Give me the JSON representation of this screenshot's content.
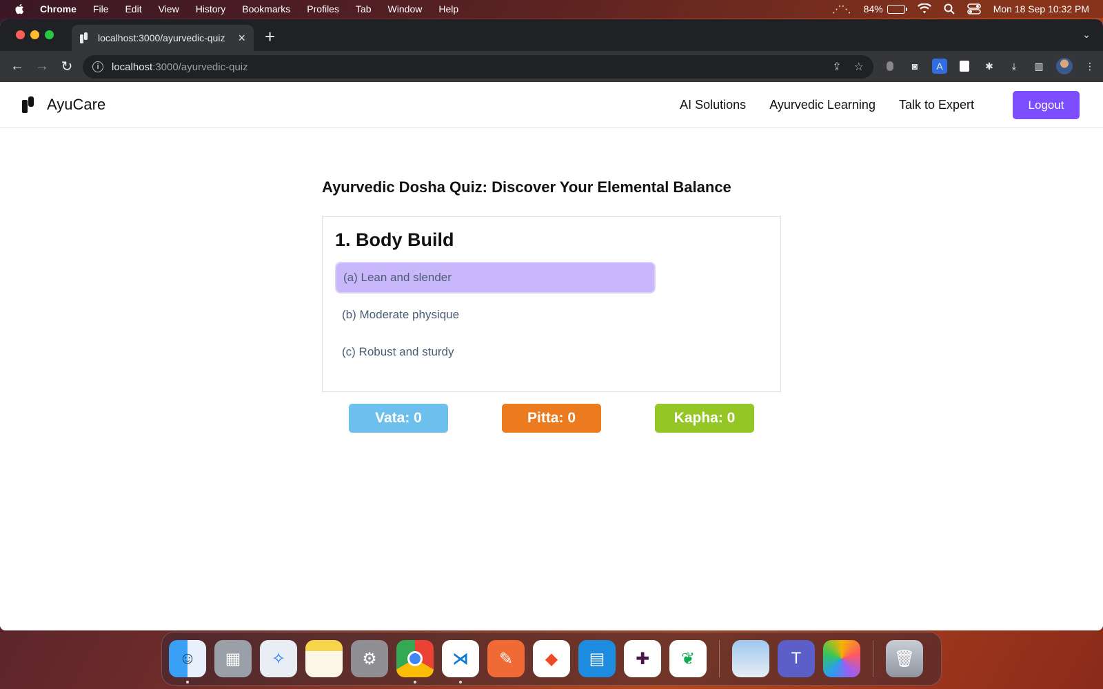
{
  "menubar": {
    "app": "Chrome",
    "items": [
      "File",
      "Edit",
      "View",
      "History",
      "Bookmarks",
      "Profiles",
      "Tab",
      "Window",
      "Help"
    ],
    "battery": "84%",
    "datetime": "Mon 18 Sep  10:32 PM"
  },
  "browser": {
    "tab_title": "localhost:3000/ayurvedic-quiz",
    "url_host": "localhost",
    "url_path": ":3000/ayurvedic-quiz"
  },
  "header": {
    "brand": "AyuCare",
    "nav": [
      "AI Solutions",
      "Ayurvedic Learning",
      "Talk to Expert"
    ],
    "logout_label": "Logout"
  },
  "quiz": {
    "title": "Ayurvedic Dosha Quiz: Discover Your Elemental Balance",
    "question": "1. Body Build",
    "options": [
      "(a) Lean and slender",
      "(b) Moderate physique",
      "(c) Robust and sturdy"
    ],
    "selected_index": 0,
    "scores": [
      {
        "label": "Vata: 0",
        "color": "#6ec0ec"
      },
      {
        "label": "Pitta: 0",
        "color": "#ec7a1e"
      },
      {
        "label": "Kapha: 0",
        "color": "#94c725"
      }
    ]
  },
  "colors": {
    "accent": "#7c4dff",
    "selected_option": "#c9b7fb"
  },
  "dock": {
    "icons": [
      "finder-icon",
      "launchpad-icon",
      "safari-icon",
      "notes-icon",
      "system-settings-icon",
      "chrome-icon",
      "vscode-icon",
      "postman-icon",
      "brave-icon",
      "docker-icon",
      "slack-icon",
      "mongodb-icon",
      "preview-icon",
      "teams-icon",
      "photos-icon",
      "trash-icon"
    ]
  }
}
